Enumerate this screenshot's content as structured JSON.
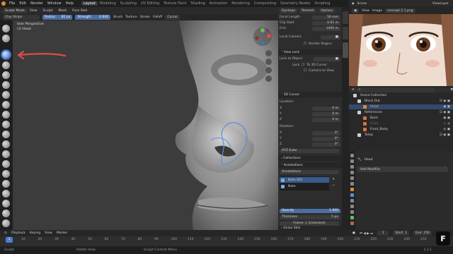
{
  "menu": {
    "items": [
      "File",
      "Edit",
      "Render",
      "Window",
      "Help"
    ],
    "tabs": [
      "Layout",
      "Modeling",
      "Sculpting",
      "UV Editing",
      "Texture Paint",
      "Shading",
      "Animation",
      "Rendering",
      "Compositing",
      "Geometry Nodes",
      "Scripting"
    ],
    "active_tab": "Layout",
    "scene": "Scene",
    "view_layer": "ViewLayer"
  },
  "viewport_header": {
    "mode": "Sculpt Mode",
    "view": "View",
    "sculpt": "Sculpt",
    "mask": "Mask",
    "face_sets": "Face Sets"
  },
  "tool_header": {
    "brush": "Clay Strips",
    "radius_label": "Radius",
    "radius_value": "85 px",
    "strength_label": "Strength",
    "strength_value": "0.600",
    "brush_menu": "Brush",
    "texture_menu": "Texture",
    "stroke_menu": "Stroke",
    "falloff_menu": "Falloff",
    "cursor_menu": "Cursor"
  },
  "overlay_text": {
    "perspective": "User Perspective",
    "object": "(1) Head"
  },
  "props": {
    "top_tabs": [
      "Dyntopo",
      "Remesh",
      "Options"
    ],
    "focal_length_label": "Focal Length",
    "focal_length": "50 mm",
    "clip_start_label": "Clip Start",
    "clip_start": "0.01 m",
    "end_label": "End",
    "end": "1000 m",
    "local_camera": "Local Camera",
    "render_region": "Render Region",
    "view_lock": "View Lock",
    "lock_to_object": "Lock to Object",
    "lock": "Lock",
    "to_3d_cursor": "To 3D Cursor",
    "camera_to_view": "Camera to View",
    "cursor_3d": "3D Cursor",
    "location": "Location:",
    "x_label": "X",
    "y_label": "Y",
    "z_label": "Z",
    "x": "0 m",
    "y": "0 m",
    "z": "0 m",
    "rotation": "Rotation:",
    "rx": "0°",
    "ry": "0°",
    "rz": "0°",
    "rotation_mode": "XYZ Euler",
    "collections": "Collections",
    "annotations": "Annotations",
    "annotations_dd": "Annotations",
    "notes": [
      "Note.001",
      "Note"
    ],
    "opacity_label": "Opacity",
    "opacity": "1.000",
    "thickness_label": "Thickness",
    "thickness": "5 px",
    "frame": "Frame: 1 (Unlocked)",
    "onion_skin": "Onion Skin"
  },
  "image_editor": {
    "view": "View",
    "image": "Image",
    "file": "concept 2.1.png"
  },
  "outliner": {
    "scene_collection": "Scene Collection",
    "rows": [
      {
        "label": "Block Out",
        "depth": 1,
        "color": "#8a8a8a"
      },
      {
        "label": "Head",
        "depth": 2,
        "color": "#e08a2c"
      },
      {
        "label": "References",
        "depth": 1,
        "color": "#8a8a8a"
      },
      {
        "label": "Back",
        "depth": 2,
        "color": "#d8723c"
      },
      {
        "label": "Front",
        "depth": 2,
        "color": "#d8723c"
      },
      {
        "label": "Front_Body",
        "depth": 2,
        "color": "#d8723c"
      },
      {
        "label": "Temp",
        "depth": 1,
        "color": "#8a8a8a"
      }
    ]
  },
  "modifier_panel": {
    "object": "Head",
    "add_modifier": "Add Modifier"
  },
  "timeline": {
    "playback": "Playback",
    "keying": "Keying",
    "view": "View",
    "marker": "Marker",
    "start_label": "Start",
    "start": "1",
    "end_label": "End",
    "end": "250",
    "current_frame": "1",
    "ticks": [
      "10",
      "20",
      "30",
      "40",
      "50",
      "60",
      "70",
      "80",
      "90",
      "100",
      "110",
      "120",
      "130",
      "140",
      "150",
      "160",
      "170",
      "180",
      "190",
      "200",
      "210",
      "220",
      "230",
      "240",
      "250"
    ]
  },
  "statusbar": {
    "sculpt": "Sculpt",
    "rotate_view": "Rotate View",
    "context_menu": "Sculpt Context Menu",
    "version": "3.3.1"
  },
  "badge": "F",
  "colors": {
    "accent_blue": "#4a6fa5",
    "arrow_red": "#e04a4a",
    "active_orange": "#e88c2c"
  }
}
